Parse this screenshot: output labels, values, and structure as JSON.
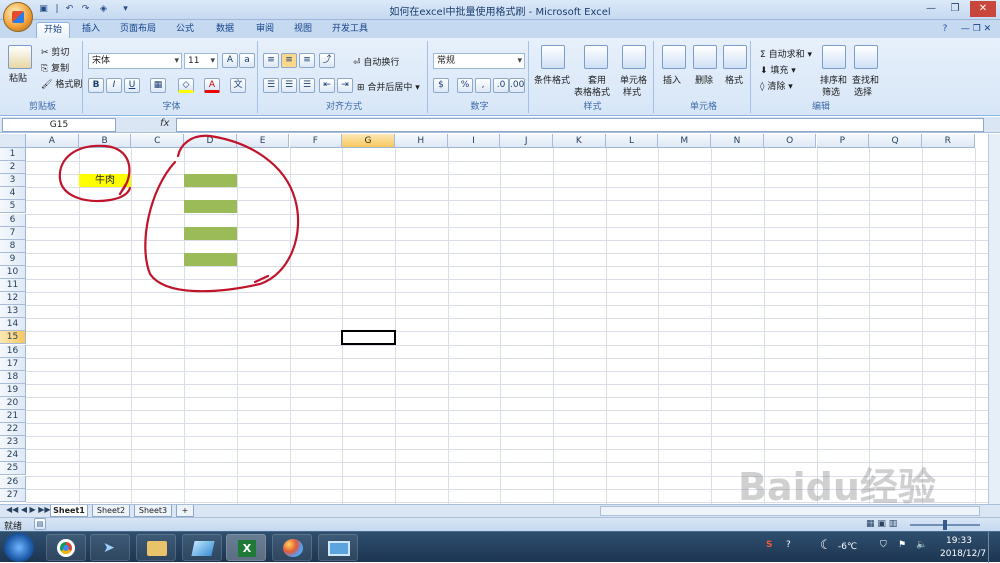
{
  "window": {
    "title": "如何在excel中批量使用格式刷 - Microsoft Excel"
  },
  "ribbon_tabs": [
    "开始",
    "插入",
    "页面布局",
    "公式",
    "数据",
    "审阅",
    "视图",
    "开发工具"
  ],
  "clipboard": {
    "paste": "粘贴",
    "cut": "剪切",
    "copy": "复制",
    "format_painter": "格式刷",
    "label": "剪贴板"
  },
  "font": {
    "name": "宋体",
    "size": "11",
    "label": "字体"
  },
  "alignment": {
    "wrap": "自动换行",
    "merge": "合并后居中",
    "label": "对齐方式"
  },
  "number": {
    "format": "常规",
    "label": "数字"
  },
  "styles": {
    "cond": "条件格式",
    "table_1": "套用",
    "table_2": "表格格式",
    "cell_1": "单元格",
    "cell_2": "样式",
    "label": "样式"
  },
  "cells": {
    "insert": "插入",
    "delete": "删除",
    "format": "格式",
    "label": "单元格"
  },
  "editing": {
    "autosum": "自动求和",
    "fill": "填充",
    "clear": "清除",
    "sort_1": "排序和",
    "sort_2": "筛选",
    "find_1": "查找和",
    "find_2": "选择",
    "label": "编辑"
  },
  "formula_bar": {
    "name_box": "G15",
    "fx": "fx"
  },
  "columns": [
    "A",
    "B",
    "C",
    "D",
    "E",
    "F",
    "G",
    "H",
    "I",
    "J",
    "K",
    "L",
    "M",
    "N",
    "O",
    "P",
    "Q",
    "R"
  ],
  "rows": [
    "1",
    "2",
    "3",
    "4",
    "5",
    "6",
    "7",
    "8",
    "9",
    "10",
    "11",
    "12",
    "13",
    "14",
    "15",
    "16",
    "17",
    "18",
    "19",
    "20",
    "21",
    "22",
    "23",
    "24",
    "25",
    "26",
    "27"
  ],
  "cells_content": {
    "B3": "牛肉"
  },
  "sheets": [
    "Sheet1",
    "Sheet2",
    "Sheet3"
  ],
  "status": {
    "mode": "就绪"
  },
  "tray": {
    "temp": "-6℃",
    "time": "19:33",
    "date": "2018/12/7"
  },
  "watermark": "Baidu经验",
  "colors": {
    "yellow_fill": "#ffff00",
    "green_fill": "#9bbb59",
    "annotation": "#c0142a",
    "selected_header": "#f8c75f"
  }
}
